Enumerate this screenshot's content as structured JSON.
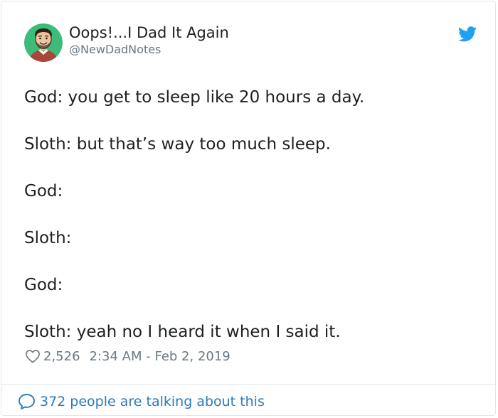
{
  "author": {
    "display_name": "Oops!...I Dad It Again",
    "handle": "@NewDadNotes",
    "avatar_icon": "cartoon-dad-avatar",
    "avatar_bg": "#3dbb7a"
  },
  "brand": {
    "icon": "twitter-bird-icon",
    "color": "#1da1f2"
  },
  "tweet": {
    "lines": [
      "God: you get to sleep like 20 hours a day.",
      "Sloth: but that’s way too much sleep.",
      "God:",
      "Sloth:",
      "God:",
      "Sloth: yeah no I heard it when I said it."
    ]
  },
  "meta": {
    "like_icon": "heart-outline-icon",
    "likes": "2,526",
    "timestamp": "2:34 AM - Feb 2, 2019"
  },
  "footer": {
    "icon": "speech-bubble-icon",
    "conversation_text": "372 people are talking about this",
    "link_color": "#2b7bb9"
  }
}
